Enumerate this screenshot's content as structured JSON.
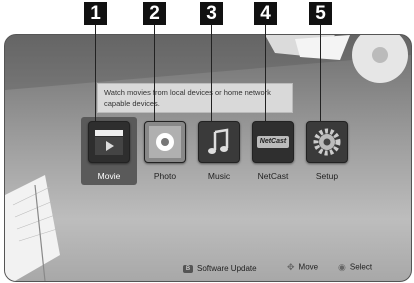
{
  "callouts": [
    "1",
    "2",
    "3",
    "4",
    "5"
  ],
  "tooltip": {
    "text": "Watch movies from local devices or home network capable devices."
  },
  "menu": {
    "items": [
      {
        "label": "Movie",
        "icon": "film-slate-icon"
      },
      {
        "label": "Photo",
        "icon": "photo-icon"
      },
      {
        "label": "Music",
        "icon": "music-note-icon"
      },
      {
        "label": "NetCast",
        "icon": "netcast-icon"
      },
      {
        "label": "Setup",
        "icon": "gear-icon"
      }
    ],
    "selected_index": 0
  },
  "netcast_logo_text": "NetCast",
  "footer": {
    "software_update": {
      "key": "B",
      "label": "Software Update"
    },
    "move": {
      "label": "Move"
    },
    "select": {
      "label": "Select"
    }
  }
}
